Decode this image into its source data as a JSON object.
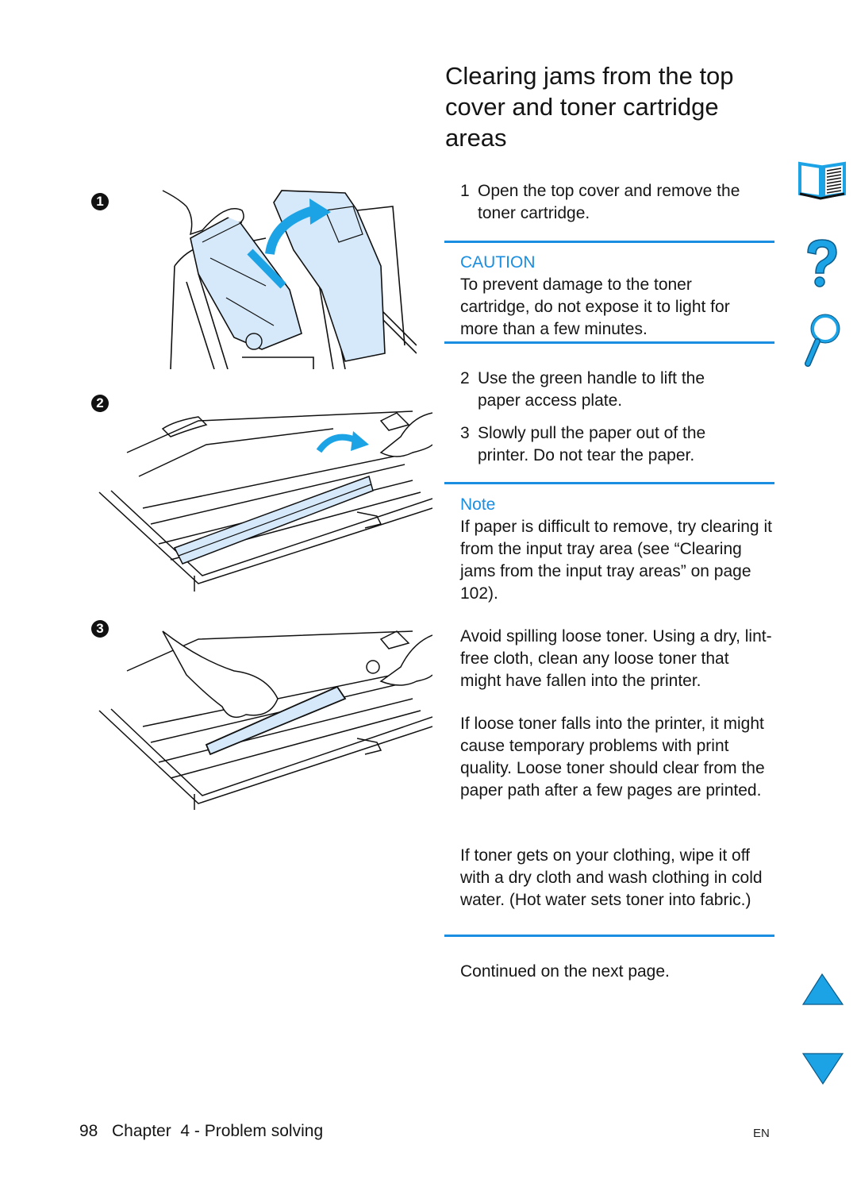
{
  "page": {
    "title": "Clearing jams from the top cover and toner cartridge areas",
    "steps": [
      {
        "number": "1",
        "text": "Open the top cover and remove the toner cartridge."
      },
      {
        "number": "2",
        "text": "Use the green handle to lift the paper access plate."
      },
      {
        "number": "3",
        "text": "Slowly pull the paper out of the printer. Do not tear the paper."
      }
    ],
    "caution": {
      "label": "CAUTION",
      "text": "To prevent damage to the toner cartridge, do not expose it to light for more than a few minutes."
    },
    "note": {
      "label": "Note",
      "text": "If paper is difficult to remove, try clearing it from the input tray area (see “Clearing jams from the input tray areas” on page 102).",
      "paragraphs": [
        "Avoid spilling loose toner. Using a dry, lint-free cloth, clean any loose toner that might have fallen into the printer.",
        "If loose toner falls into the printer, it might cause temporary problems with print quality. Loose toner should clear from the paper path after a few pages are printed.",
        "If toner gets on your clothing, wipe it off with a dry cloth and wash clothing in cold water. (Hot water sets toner into fabric.)"
      ]
    },
    "continued": "Continued on the next page.",
    "figures": [
      {
        "callout": "1",
        "alt": "Opening the top cover and removing the toner cartridge"
      },
      {
        "callout": "2",
        "alt": "Lifting the paper access plate with the green handle"
      },
      {
        "callout": "3",
        "alt": "Pulling jammed paper out of the printer"
      }
    ]
  },
  "footer": {
    "page_number": "98",
    "chapter": "Chapter  4 - Problem solving",
    "language": "EN"
  },
  "nav_icons": {
    "contents": "book-icon",
    "help": "question-icon",
    "index": "magnifier-icon",
    "previous": "triangle-up-icon",
    "next": "triangle-down-icon"
  },
  "colors": {
    "accent": "#1a8ee0",
    "illustration_fill": "#d6e9fa",
    "nav_icon": "#1ba3e6"
  }
}
